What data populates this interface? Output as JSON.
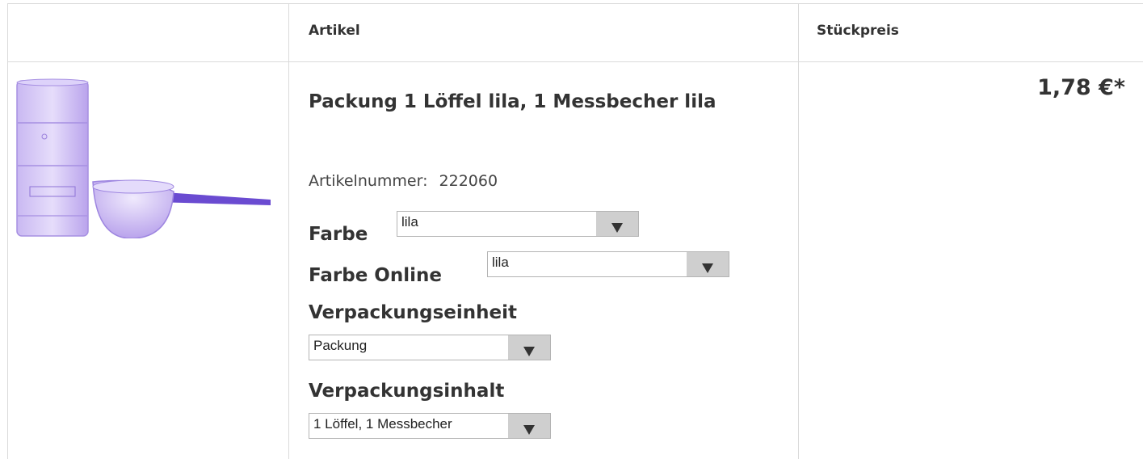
{
  "table": {
    "headers": {
      "image": "",
      "article": "Artikel",
      "unit_price": "Stückpreis"
    }
  },
  "product": {
    "title": "Packung 1 Löffel lila, 1 Messbecher lila",
    "article_number_label": "Artikelnummer:",
    "article_number": "222060",
    "price": "1,78 €*",
    "image_icon": "product-photo-measuring-cup-and-spoon",
    "image_colors": {
      "plastic": "#b9a3ec",
      "handle": "#6a4bd1"
    },
    "options": [
      {
        "label": "Farbe",
        "value": "lila"
      },
      {
        "label": "Farbe Online",
        "value": "lila"
      },
      {
        "label": "Verpackungseinheit",
        "value": "Packung"
      },
      {
        "label": "Verpackungsinhalt",
        "value": "1 Löffel, 1 Messbecher"
      }
    ]
  }
}
